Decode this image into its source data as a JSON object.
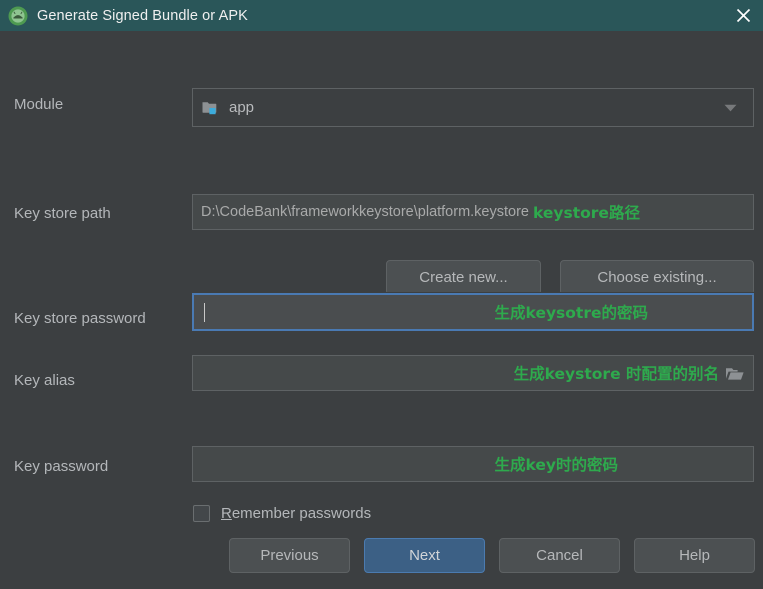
{
  "window": {
    "title": "Generate Signed Bundle or APK",
    "app_icon": "android-studio-icon",
    "close_icon": "close-icon",
    "titlebar_color": "#2a5659",
    "background_color": "#3c3f41"
  },
  "form": {
    "module": {
      "label": "Module",
      "value": "app",
      "icon": "module-folder-icon",
      "dropdown_icon": "chevron-down-icon"
    },
    "key_store_path": {
      "label": "Key store path",
      "value": "D:\\CodeBank\\frameworkkeystore\\platform.keystore",
      "annotation": "keystore路径"
    },
    "create_new_button": "Create new...",
    "choose_existing_button": "Choose existing...",
    "key_store_password": {
      "label": "Key store password",
      "value": "",
      "annotation": "生成keysotre的密码",
      "focused": true
    },
    "key_alias": {
      "label": "Key alias",
      "value": "",
      "annotation": "生成keystore 时配置的别名",
      "browse_icon": "folder-open-icon"
    },
    "key_password": {
      "label": "Key password",
      "value": "",
      "annotation": "生成key时的密码"
    },
    "remember_passwords": {
      "label_mnemonic": "R",
      "label_rest": "emember passwords",
      "checked": false
    }
  },
  "footer": {
    "previous": "Previous",
    "next": "Next",
    "cancel": "Cancel",
    "help": "Help"
  },
  "colors": {
    "accent_blue": "#3c6085",
    "annotation_green": "#2eaa4d",
    "focus_border": "#4a7ab3"
  }
}
